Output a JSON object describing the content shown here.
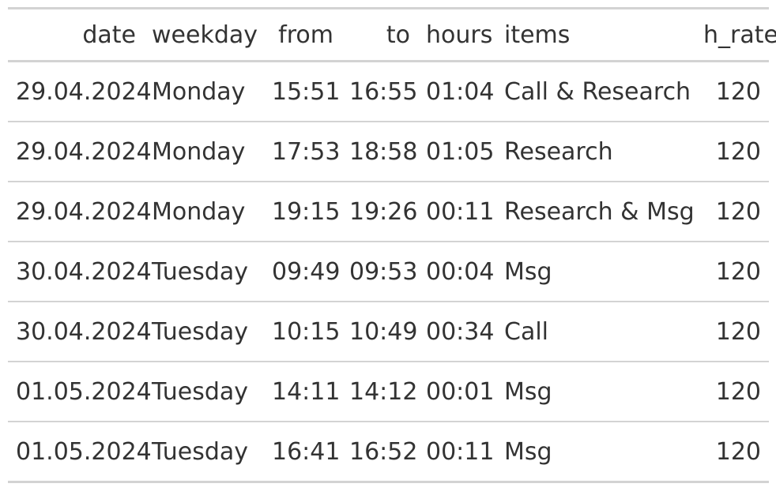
{
  "table": {
    "columns": [
      {
        "key": "date",
        "label": "date",
        "align": "right"
      },
      {
        "key": "weekday",
        "label": "weekday",
        "align": "left"
      },
      {
        "key": "from",
        "label": "from",
        "align": "right"
      },
      {
        "key": "to",
        "label": "to",
        "align": "right"
      },
      {
        "key": "hours",
        "label": "hours",
        "align": "right"
      },
      {
        "key": "items",
        "label": "items",
        "align": "left"
      },
      {
        "key": "h_rate",
        "label": "h_rate",
        "align": "right"
      }
    ],
    "rows": [
      {
        "date": "29.04.2024",
        "weekday": "Monday",
        "from": "15:51",
        "to": "16:55",
        "hours": "01:04",
        "items": "Call & Research",
        "h_rate": "120"
      },
      {
        "date": "29.04.2024",
        "weekday": "Monday",
        "from": "17:53",
        "to": "18:58",
        "hours": "01:05",
        "items": "Research",
        "h_rate": "120"
      },
      {
        "date": "29.04.2024",
        "weekday": "Monday",
        "from": "19:15",
        "to": "19:26",
        "hours": "00:11",
        "items": "Research & Msg",
        "h_rate": "120"
      },
      {
        "date": "30.04.2024",
        "weekday": "Tuesday",
        "from": "09:49",
        "to": "09:53",
        "hours": "00:04",
        "items": "Msg",
        "h_rate": "120"
      },
      {
        "date": "30.04.2024",
        "weekday": "Tuesday",
        "from": "10:15",
        "to": "10:49",
        "hours": "00:34",
        "items": "Call",
        "h_rate": "120"
      },
      {
        "date": "01.05.2024",
        "weekday": "Tuesday",
        "from": "14:11",
        "to": "14:12",
        "hours": "00:01",
        "items": "Msg",
        "h_rate": "120"
      },
      {
        "date": "01.05.2024",
        "weekday": "Tuesday",
        "from": "16:41",
        "to": "16:52",
        "hours": "00:11",
        "items": "Msg",
        "h_rate": "120"
      }
    ]
  },
  "colors": {
    "text": "#333333",
    "rule": "#d3d3d3",
    "background": "#ffffff"
  }
}
